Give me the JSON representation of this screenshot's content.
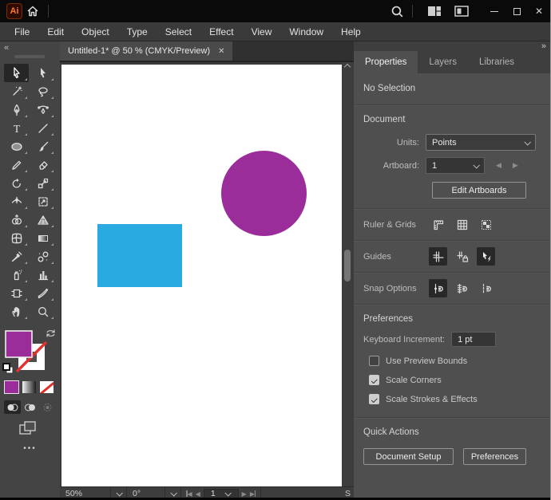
{
  "titlebar": {
    "app_badge": "Ai",
    "controls": {
      "minimize": "",
      "maximize": "",
      "close": "✕"
    }
  },
  "menubar": {
    "items": [
      "File",
      "Edit",
      "Object",
      "Type",
      "Select",
      "Effect",
      "View",
      "Window",
      "Help"
    ]
  },
  "document_tab": {
    "title": "Untitled-1* @ 50 % (CMYK/Preview)",
    "close_glyph": "✕"
  },
  "toolbar": {
    "collapse_glyph": "«",
    "ellipsis_glyph": "•••"
  },
  "canvas": {
    "rectangle_fill": "#29ABE2",
    "circle_fill": "#9B2D9B",
    "artboard_background": "#FFFFFF"
  },
  "statusbar": {
    "zoom_value": "50%",
    "rotation_value": "0°",
    "artboard_nav": {
      "first": "◀",
      "prev": "◀",
      "current": "1",
      "next": "▶",
      "last": "▶"
    },
    "status_text": "S"
  },
  "panel": {
    "collapse_glyph": "»",
    "tabs": [
      {
        "label": "Properties"
      },
      {
        "label": "Layers"
      },
      {
        "label": "Libraries"
      }
    ],
    "no_selection": "No Selection",
    "document": {
      "title": "Document",
      "units_label": "Units:",
      "units_value": "Points",
      "artboard_label": "Artboard:",
      "artboard_value": "1",
      "edit_artboards_label": "Edit Artboards"
    },
    "sections": {
      "ruler_grids": "Ruler & Grids",
      "guides": "Guides",
      "snap_options": "Snap Options"
    },
    "preferences": {
      "title": "Preferences",
      "keyboard_increment_label": "Keyboard Increment:",
      "keyboard_increment_value": "1 pt",
      "checkbox_use_preview_bounds": "Use Preview Bounds",
      "checkbox_scale_corners": "Scale Corners",
      "checkbox_scale_strokes": "Scale Strokes & Effects"
    },
    "quick_actions": {
      "title": "Quick Actions",
      "document_setup_label": "Document Setup",
      "preferences_label": "Preferences"
    }
  },
  "colors": {
    "fill_swatch": "#9B2D9B",
    "stroke_swatch": "none",
    "active_tool_bg": "#262626"
  }
}
